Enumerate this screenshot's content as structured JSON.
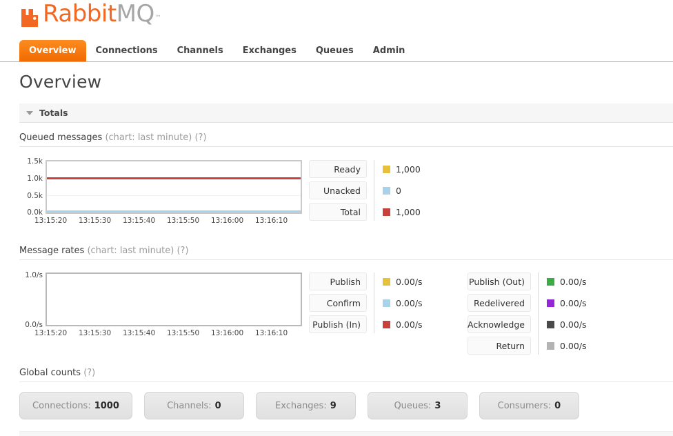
{
  "brand": {
    "name_part1": "Rabbit",
    "name_part2": "MQ",
    "trademark": "™",
    "logo_icon": "rabbitmq-logo-icon",
    "orange": "#f26722",
    "gray": "#a6a6a6"
  },
  "nav": {
    "tabs": [
      {
        "label": "Overview",
        "active": true
      },
      {
        "label": "Connections",
        "active": false
      },
      {
        "label": "Channels",
        "active": false
      },
      {
        "label": "Exchanges",
        "active": false
      },
      {
        "label": "Queues",
        "active": false
      },
      {
        "label": "Admin",
        "active": false
      }
    ]
  },
  "page": {
    "title": "Overview"
  },
  "totals_section": {
    "label": "Totals",
    "expanded": true,
    "caret_icon": "caret-down-icon"
  },
  "queued_messages": {
    "title": "Queued messages",
    "subtitle": "(chart: last minute)",
    "help": "(?)"
  },
  "message_rates": {
    "title": "Message rates",
    "subtitle": "(chart: last minute)",
    "help": "(?)"
  },
  "global_counts": {
    "title": "Global counts",
    "help": "(?)",
    "items": [
      {
        "label": "Connections:",
        "value": "1000"
      },
      {
        "label": "Channels:",
        "value": "0"
      },
      {
        "label": "Exchanges:",
        "value": "9"
      },
      {
        "label": "Queues:",
        "value": "3"
      },
      {
        "label": "Consumers:",
        "value": "0"
      }
    ]
  },
  "queued_legend": [
    {
      "label": "Ready",
      "value": "1,000",
      "color": "#e8c13c"
    },
    {
      "label": "Unacked",
      "value": "0",
      "color": "#a8d2ea"
    },
    {
      "label": "Total",
      "value": "1,000",
      "color": "#c9413c"
    }
  ],
  "rates_legend_left": [
    {
      "label": "Publish",
      "value": "0.00/s",
      "color": "#e8c13c"
    },
    {
      "label": "Confirm",
      "value": "0.00/s",
      "color": "#a8d2ea"
    },
    {
      "label": "Publish (In)",
      "value": "0.00/s",
      "color": "#c9413c"
    }
  ],
  "rates_legend_right": [
    {
      "label": "Publish (Out)",
      "value": "0.00/s",
      "color": "#3bab45"
    },
    {
      "label": "Redelivered",
      "value": "0.00/s",
      "color": "#9327d6"
    },
    {
      "label": "Acknowledge",
      "value": "0.00/s",
      "color": "#4a4a4a"
    },
    {
      "label": "Return",
      "value": "0.00/s",
      "color": "#b3b3b3"
    }
  ],
  "chart_data": [
    {
      "type": "line",
      "title": "Queued messages (chart: last minute)",
      "xlabel": "",
      "ylabel": "",
      "ylim": [
        0,
        1500
      ],
      "yticks": [
        "0.0k",
        "0.5k",
        "1.0k",
        "1.5k"
      ],
      "ytick_values": [
        0,
        500,
        1000,
        1500
      ],
      "x": [
        "13:15:20",
        "13:15:30",
        "13:15:40",
        "13:15:50",
        "13:16:00",
        "13:16:10"
      ],
      "grid": true,
      "legend_position": "right",
      "series": [
        {
          "name": "Total",
          "color": "#c9413c",
          "values": [
            1000,
            1000,
            1000,
            1000,
            1000,
            1000
          ]
        },
        {
          "name": "Ready",
          "color": "#e8c13c",
          "values": [
            1000,
            1000,
            1000,
            1000,
            1000,
            1000
          ]
        },
        {
          "name": "Unacked",
          "color": "#a8d2ea",
          "values": [
            0,
            0,
            0,
            0,
            0,
            0
          ]
        }
      ]
    },
    {
      "type": "line",
      "title": "Message rates (chart: last minute)",
      "xlabel": "",
      "ylabel": "",
      "ylim": [
        0,
        1
      ],
      "yticks": [
        "0.0/s",
        "1.0/s"
      ],
      "ytick_values": [
        0,
        1
      ],
      "x": [
        "13:15:20",
        "13:15:30",
        "13:15:40",
        "13:15:50",
        "13:16:00",
        "13:16:10"
      ],
      "grid": false,
      "legend_position": "right",
      "series": [
        {
          "name": "Publish",
          "color": "#e8c13c",
          "values": [
            0,
            0,
            0,
            0,
            0,
            0
          ]
        },
        {
          "name": "Confirm",
          "color": "#a8d2ea",
          "values": [
            0,
            0,
            0,
            0,
            0,
            0
          ]
        },
        {
          "name": "Publish (In)",
          "color": "#c9413c",
          "values": [
            0,
            0,
            0,
            0,
            0,
            0
          ]
        },
        {
          "name": "Publish (Out)",
          "color": "#3bab45",
          "values": [
            0,
            0,
            0,
            0,
            0,
            0
          ]
        },
        {
          "name": "Redelivered",
          "color": "#9327d6",
          "values": [
            0,
            0,
            0,
            0,
            0,
            0
          ]
        },
        {
          "name": "Acknowledge",
          "color": "#4a4a4a",
          "values": [
            0,
            0,
            0,
            0,
            0,
            0
          ]
        },
        {
          "name": "Return",
          "color": "#b3b3b3",
          "values": [
            0,
            0,
            0,
            0,
            0,
            0
          ]
        }
      ]
    }
  ]
}
